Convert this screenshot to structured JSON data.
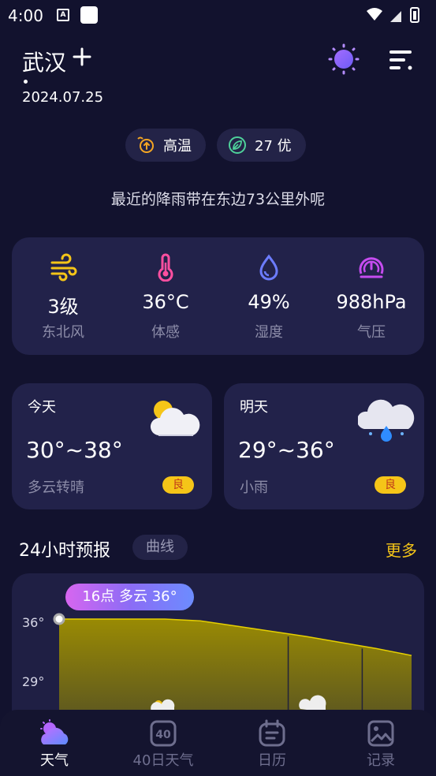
{
  "status_bar": {
    "time": "4:00",
    "notif_icon_letter": "A"
  },
  "header": {
    "city": "武汉",
    "date": "2024.07.25"
  },
  "pills": [
    {
      "label": "高温",
      "icon": "temperature-up-icon",
      "color": "#f5a623"
    },
    {
      "label": "27 优",
      "icon": "leaf-icon",
      "color": "#4ed19a"
    }
  ],
  "rain_note": "最近的降雨带在东边73公里外呢",
  "stats": [
    {
      "value": "3级",
      "label": "东北风",
      "icon": "wind-icon",
      "color": "#f5c518"
    },
    {
      "value": "36°C",
      "label": "体感",
      "icon": "thermometer-icon",
      "color": "#ff4fa0"
    },
    {
      "value": "49%",
      "label": "湿度",
      "icon": "humidity-icon",
      "color": "#6c7cff"
    },
    {
      "value": "988hPa",
      "label": "气压",
      "icon": "pressure-gauge-icon",
      "color": "#c64cf0"
    }
  ],
  "days": [
    {
      "name": "今天",
      "range": "30°~38°",
      "desc": "多云转晴",
      "aqi": "良",
      "icon": "partly-cloudy-sun-icon"
    },
    {
      "name": "明天",
      "range": "29°~36°",
      "desc": "小雨",
      "aqi": "良",
      "icon": "light-rain-icon"
    }
  ],
  "forecast": {
    "title": "24小时预报",
    "mode_tab": "曲线",
    "more": "更多",
    "tooltip": "16点 多云 36°",
    "y_ticks": [
      "36°",
      "29°"
    ]
  },
  "chart_data": {
    "type": "area",
    "y_ticks": [
      "36°",
      "29°"
    ],
    "x_index": [
      0,
      1,
      2,
      3,
      4,
      5,
      6,
      7,
      8,
      9,
      10
    ],
    "values": [
      36,
      36,
      36,
      36,
      35.8,
      35.2,
      34.6,
      34.0,
      33.3,
      32.6,
      31.8
    ],
    "color": "#c8b400"
  },
  "nav": [
    {
      "label": "天气",
      "icon": "weather-icon",
      "active": true
    },
    {
      "label": "40日天气",
      "icon": "calendar-40-icon",
      "active": false
    },
    {
      "label": "日历",
      "icon": "calendar-icon",
      "active": false
    },
    {
      "label": "记录",
      "icon": "photo-record-icon",
      "active": false
    }
  ]
}
